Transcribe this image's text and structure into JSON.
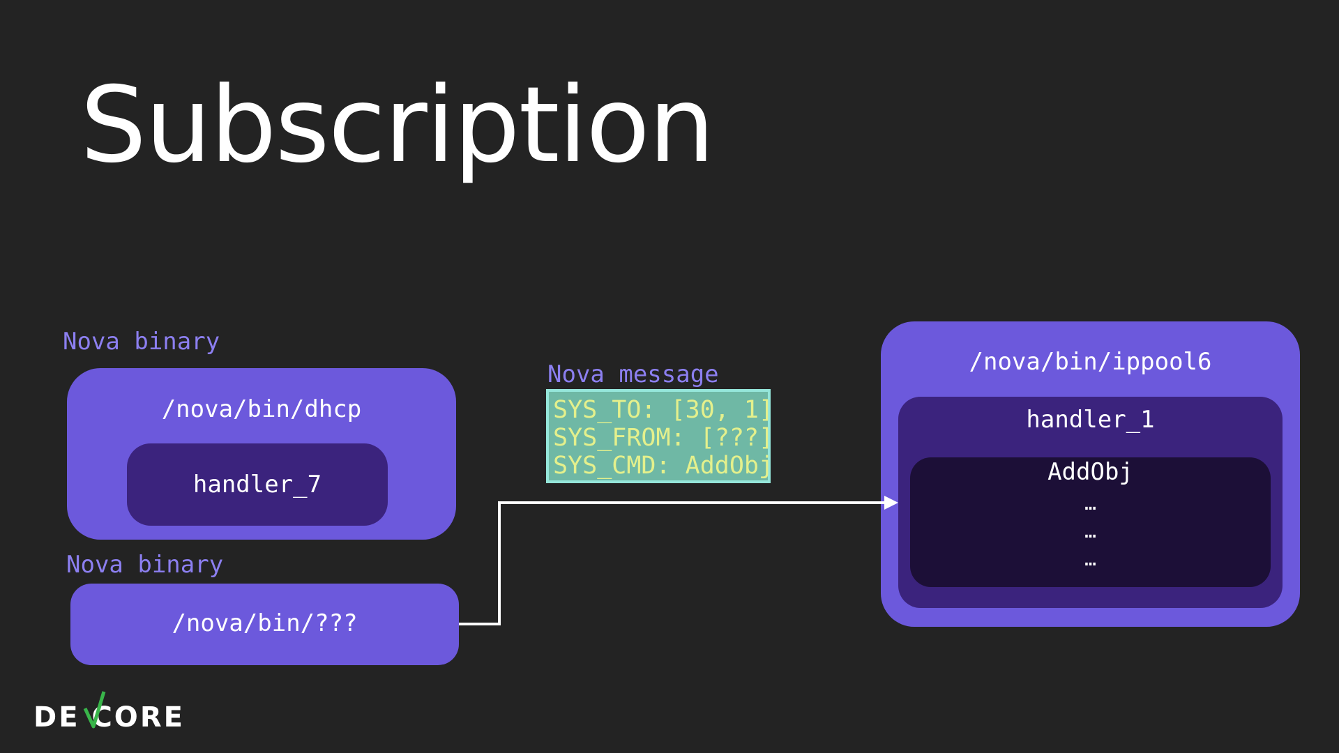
{
  "slide": {
    "title": "Subscription"
  },
  "left_top": {
    "label": "Nova binary",
    "path": "/nova/bin/dhcp",
    "handler": "handler_7"
  },
  "left_bottom": {
    "label": "Nova binary",
    "path": "/nova/bin/???"
  },
  "message": {
    "label": "Nova message",
    "lines": [
      "SYS_TO: [30, 1]",
      "SYS_FROM: [???]",
      "SYS_CMD: AddObj"
    ]
  },
  "right": {
    "path": "/nova/bin/ippool6",
    "handler": "handler_1",
    "command": "AddObj",
    "ellipses": [
      "…",
      "…",
      "…"
    ]
  },
  "logo": {
    "text": "DEVCORE"
  },
  "colors": {
    "background": "#232323",
    "box_outer": "#6c59dc",
    "box_mid": "#3b237d",
    "box_inner": "#1c0f37",
    "label": "#8c7ff0",
    "message_fill": "#6fb8a5",
    "message_border": "#95e6da",
    "message_text": "#e4f08c",
    "logo_check": "#39b54a"
  }
}
